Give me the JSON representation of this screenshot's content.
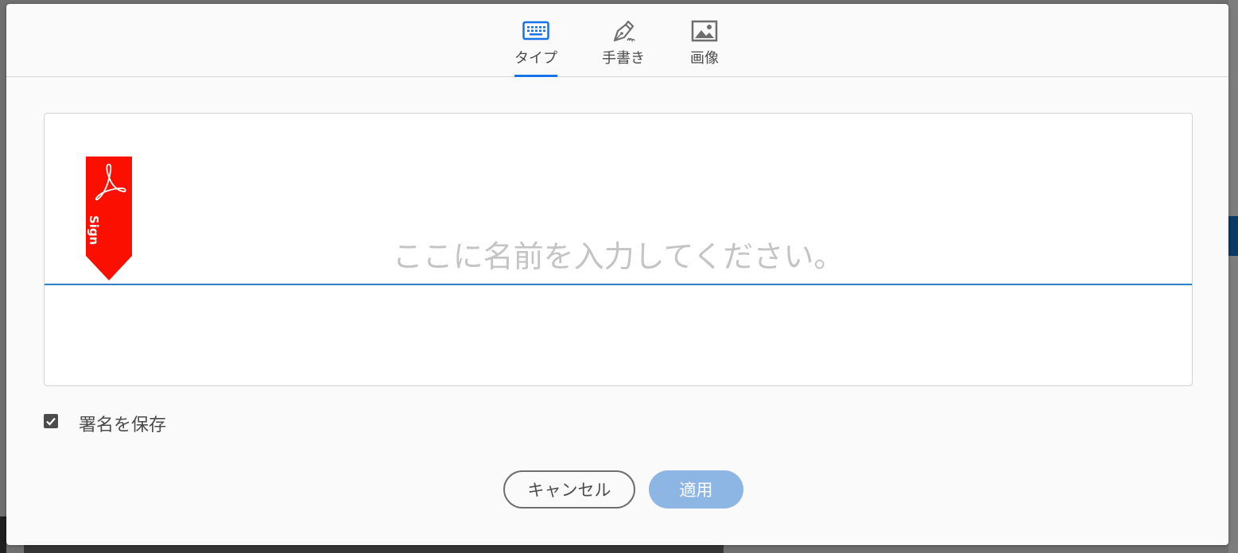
{
  "tabs": [
    {
      "key": "type",
      "label": "タイプ",
      "icon": "keyboard-icon",
      "active": true
    },
    {
      "key": "draw",
      "label": "手書き",
      "icon": "pen-icon",
      "active": false
    },
    {
      "key": "image",
      "label": "画像",
      "icon": "image-icon",
      "active": false
    }
  ],
  "signature": {
    "placeholder": "ここに名前を入力してください。",
    "value": "",
    "flag_label": "Sign",
    "flag_icon": "acrobat-icon"
  },
  "save_option": {
    "label": "署名を保存",
    "checked": true
  },
  "buttons": {
    "cancel": "キャンセル",
    "apply": "適用",
    "apply_enabled": false
  },
  "colors": {
    "accent": "#1473e6",
    "underline": "#2d7fc8",
    "flag": "#fa0f00",
    "apply_disabled": "#8eb6e4",
    "text": "#4b4b4b"
  }
}
